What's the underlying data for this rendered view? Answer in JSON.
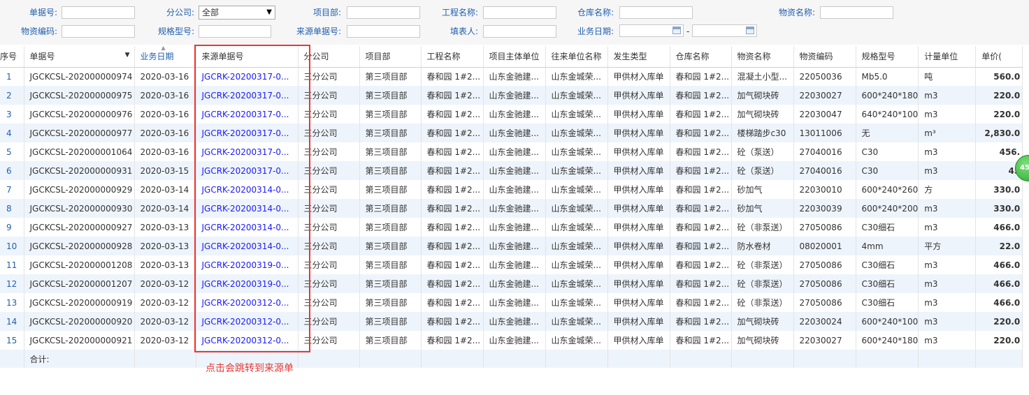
{
  "filters": {
    "doc_no": "单据号:",
    "branch": "分公司:",
    "branch_value": "全部",
    "project_dept": "项目部:",
    "project_name": "工程名称:",
    "warehouse": "仓库名称:",
    "material_name": "物资名称:",
    "material_code": "物资编码:",
    "spec_model": "规格型号:",
    "source_no": "来源单据号:",
    "filler": "填表人:",
    "biz_date": "业务日期:",
    "date_sep": "-"
  },
  "columns": [
    "序号",
    "单据号",
    "业务日期",
    "来源单据号",
    "分公司",
    "项目部",
    "工程名称",
    "项目主体单位",
    "往来单位名称",
    "发生类型",
    "仓库名称",
    "物资名称",
    "物资编码",
    "规格型号",
    "计量单位",
    "单价("
  ],
  "rows": [
    [
      "1",
      "JGCKCSL-202000000974",
      "2020-03-16",
      "JGCRK-20200317-0...",
      "三分公司",
      "第三项目部",
      "春和园 1#2...",
      "山东金驰建...",
      "山东金城荣...",
      "甲供材入库单",
      "春和园 1#2...",
      "混凝土小型...",
      "22050036",
      "Mb5.0",
      "吨",
      "560.0"
    ],
    [
      "2",
      "JGCKCSL-202000000975",
      "2020-03-16",
      "JGCRK-20200317-0...",
      "三分公司",
      "第三项目部",
      "春和园 1#2...",
      "山东金驰建...",
      "山东金城荣...",
      "甲供材入库单",
      "春和园 1#2...",
      "加气砌块砖",
      "22030027",
      "600*240*180",
      "m3",
      "220.0"
    ],
    [
      "3",
      "JGCKCSL-202000000976",
      "2020-03-16",
      "JGCRK-20200317-0...",
      "三分公司",
      "第三项目部",
      "春和园 1#2...",
      "山东金驰建...",
      "山东金城荣...",
      "甲供材入库单",
      "春和园 1#2...",
      "加气砌块砖",
      "22030047",
      "640*240*100",
      "m3",
      "220.0"
    ],
    [
      "4",
      "JGCKCSL-202000000977",
      "2020-03-16",
      "JGCRK-20200317-0...",
      "三分公司",
      "第三项目部",
      "春和园 1#2...",
      "山东金驰建...",
      "山东金城荣...",
      "甲供材入库单",
      "春和园 1#2...",
      "楼梯踏步c30",
      "13011006",
      "无",
      "m³",
      "2,830.0"
    ],
    [
      "5",
      "JGCKCSL-202000001064",
      "2020-03-16",
      "JGCRK-20200317-0...",
      "三分公司",
      "第三项目部",
      "春和园 1#2...",
      "山东金驰建...",
      "山东金城荣...",
      "甲供材入库单",
      "春和园 1#2...",
      "砼（泵送）",
      "27040016",
      "C30",
      "m3",
      "456."
    ],
    [
      "6",
      "JGCKCSL-202000000931",
      "2020-03-15",
      "JGCRK-20200317-0...",
      "三分公司",
      "第三项目部",
      "春和园 1#2...",
      "山东金驰建...",
      "山东金城荣...",
      "甲供材入库单",
      "春和园 1#2...",
      "砼（泵送）",
      "27040016",
      "C30",
      "m3",
      "45"
    ],
    [
      "7",
      "JGCKCSL-202000000929",
      "2020-03-14",
      "JGCRK-20200314-0...",
      "三分公司",
      "第三项目部",
      "春和园 1#2...",
      "山东金驰建...",
      "山东金城荣...",
      "甲供材入库单",
      "春和园 1#2...",
      "砂加气",
      "22030010",
      "600*240*260",
      "方",
      "330.0"
    ],
    [
      "8",
      "JGCKCSL-202000000930",
      "2020-03-14",
      "JGCRK-20200314-0...",
      "三分公司",
      "第三项目部",
      "春和园 1#2...",
      "山东金驰建...",
      "山东金城荣...",
      "甲供材入库单",
      "春和园 1#2...",
      "砂加气",
      "22030039",
      "600*240*200",
      "m3",
      "330.0"
    ],
    [
      "9",
      "JGCKCSL-202000000927",
      "2020-03-13",
      "JGCRK-20200314-0...",
      "三分公司",
      "第三项目部",
      "春和园 1#2...",
      "山东金驰建...",
      "山东金城荣...",
      "甲供材入库单",
      "春和园 1#2...",
      "砼（非泵送）",
      "27050086",
      "C30细石",
      "m3",
      "466.0"
    ],
    [
      "10",
      "JGCKCSL-202000000928",
      "2020-03-13",
      "JGCRK-20200314-0...",
      "三分公司",
      "第三项目部",
      "春和园 1#2...",
      "山东金驰建...",
      "山东金城荣...",
      "甲供材入库单",
      "春和园 1#2...",
      "防水卷材",
      "08020001",
      "4mm",
      "平方",
      "22.0"
    ],
    [
      "11",
      "JGCKCSL-202000001208",
      "2020-03-13",
      "JGCRK-20200319-0...",
      "三分公司",
      "第三项目部",
      "春和园 1#2...",
      "山东金驰建...",
      "山东金城荣...",
      "甲供材入库单",
      "春和园 1#2...",
      "砼（非泵送）",
      "27050086",
      "C30细石",
      "m3",
      "466.0"
    ],
    [
      "12",
      "JGCKCSL-202000001207",
      "2020-03-12",
      "JGCRK-20200319-0...",
      "三分公司",
      "第三项目部",
      "春和园 1#2...",
      "山东金驰建...",
      "山东金城荣...",
      "甲供材入库单",
      "春和园 1#2...",
      "砼（非泵送）",
      "27050086",
      "C30细石",
      "m3",
      "466.0"
    ],
    [
      "13",
      "JGCKCSL-202000000919",
      "2020-03-12",
      "JGCRK-20200312-0...",
      "三分公司",
      "第三项目部",
      "春和园 1#2...",
      "山东金驰建...",
      "山东金城荣...",
      "甲供材入库单",
      "春和园 1#2...",
      "砼（非泵送）",
      "27050086",
      "C30细石",
      "m3",
      "466.0"
    ],
    [
      "14",
      "JGCKCSL-202000000920",
      "2020-03-12",
      "JGCRK-20200312-0...",
      "三分公司",
      "第三项目部",
      "春和园 1#2...",
      "山东金驰建...",
      "山东金城荣...",
      "甲供材入库单",
      "春和园 1#2...",
      "加气砌块砖",
      "22030024",
      "600*240*100",
      "m3",
      "220.0"
    ],
    [
      "15",
      "JGCKCSL-202000000921",
      "2020-03-12",
      "JGCRK-20200312-0...",
      "三分公司",
      "第三项目部",
      "春和园 1#2...",
      "山东金驰建...",
      "山东金城荣...",
      "甲供材入库单",
      "春和园 1#2...",
      "加气砌块砖",
      "22030027",
      "600*240*180",
      "m3",
      "220.0"
    ]
  ],
  "total_label": "合计:",
  "annotation": "点击会跳转到来源单",
  "bubble_text": "45",
  "colors": {
    "label_blue": "#1f5fae",
    "link_blue": "#1a1aff",
    "annot_red": "#e53935",
    "row_alt": "#eef4fb"
  }
}
